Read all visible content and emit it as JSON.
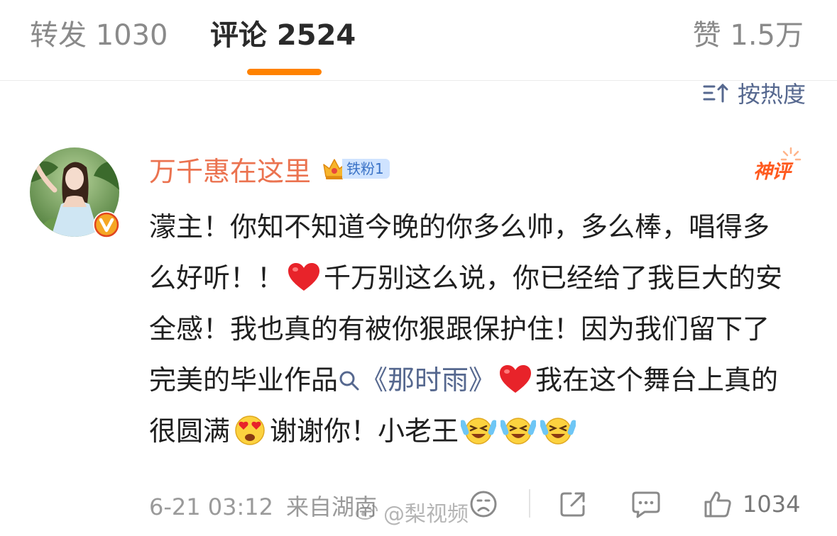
{
  "tabs": {
    "repost": "转发 1030",
    "comment": "评论 2524",
    "like": "赞 1.5万"
  },
  "sort": {
    "label": "按热度"
  },
  "comment": {
    "author": "万千惠在这里",
    "fan_badge": "铁粉1",
    "tag": "神评",
    "text": {
      "p1": "濛主！你知不知道今晚的你多么帅，多么棒，唱得多么好听！！",
      "p2": "千万别这么说，你已经给了我巨大的安全感！我也真的有被你狠跟保护住！因为我们留下了完美的毕业作品",
      "link": "《那时雨》",
      "p3": "我在这个舞台上真的很圆满",
      "p4": "谢谢你！小老王"
    },
    "emojis": [
      "heart",
      "heart",
      "heart-eyes-face",
      "crying-laughing-face",
      "crying-laughing-face",
      "crying-laughing-face"
    ],
    "date": "6-21 03:12",
    "location": "来自湖南",
    "likes": "1034"
  },
  "watermark": "@梨视频",
  "colors": {
    "accent": "#ff8200",
    "author": "#eb7350",
    "link": "#56688f",
    "god_comment": "#ff5a1f"
  }
}
